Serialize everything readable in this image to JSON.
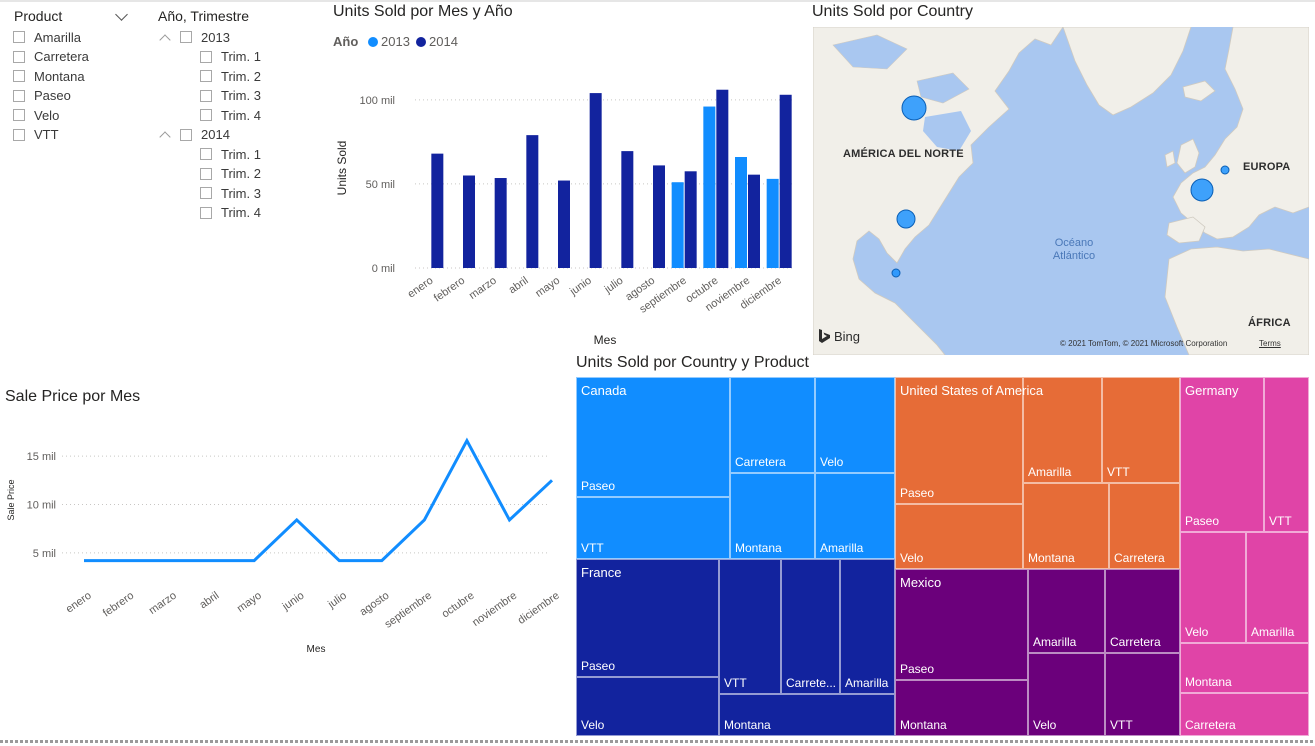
{
  "product_slicer": {
    "title": "Product",
    "items": [
      "Amarilla",
      "Carretera",
      "Montana",
      "Paseo",
      "Velo",
      "VTT"
    ]
  },
  "date_slicer": {
    "title": "Año, Trimestre",
    "years": [
      {
        "label": "2013",
        "quarters": [
          "Trim. 1",
          "Trim. 2",
          "Trim. 3",
          "Trim. 4"
        ]
      },
      {
        "label": "2014",
        "quarters": [
          "Trim. 1",
          "Trim. 2",
          "Trim. 3",
          "Trim. 4"
        ]
      }
    ]
  },
  "bar_chart_title": "Units Sold por Mes y Año",
  "line_chart_title": "Sale Price por Mes",
  "map_title": "Units Sold por Country",
  "treemap_title": "Units Sold por Country y Product",
  "chart_data": [
    {
      "type": "bar",
      "title": "Units Sold por Mes y Año",
      "legend_title": "Año",
      "legend_position": "top-left",
      "xlabel": "Mes",
      "ylabel": "Units Sold",
      "categories": [
        "enero",
        "febrero",
        "marzo",
        "abril",
        "mayo",
        "junio",
        "julio",
        "agosto",
        "septiembre",
        "octubre",
        "noviembre",
        "diciembre"
      ],
      "series": [
        {
          "name": "2013",
          "color": "#118DFF",
          "values": [
            null,
            null,
            null,
            null,
            null,
            null,
            null,
            null,
            51000,
            96000,
            66000,
            53000
          ]
        },
        {
          "name": "2014",
          "color": "#12239E",
          "values": [
            68000,
            55000,
            53500,
            79000,
            52000,
            104000,
            69500,
            61000,
            57500,
            106000,
            55500,
            103000
          ]
        }
      ],
      "yticks": [
        "0 mil",
        "50 mil",
        "100 mil"
      ],
      "ylim": [
        0,
        110000
      ],
      "grid": true
    },
    {
      "type": "line",
      "title": "Sale Price por Mes",
      "xlabel": "Mes",
      "ylabel": "Sale Price",
      "categories": [
        "enero",
        "febrero",
        "marzo",
        "abril",
        "mayo",
        "junio",
        "julio",
        "agosto",
        "septiembre",
        "octubre",
        "noviembre",
        "diciembre"
      ],
      "series": [
        {
          "color": "#118DFF",
          "values": [
            4200,
            4200,
            4200,
            4200,
            4200,
            8400,
            4200,
            4200,
            8400,
            16600,
            8400,
            12500
          ]
        }
      ],
      "yticks": [
        "5 mil",
        "10 mil",
        "15 mil"
      ],
      "ylim": [
        2500,
        17500
      ],
      "grid": true
    }
  ],
  "map": {
    "labels": [
      "AMÉRICA DEL NORTE",
      "EUROPA",
      "ÁFRICA"
    ],
    "ocean_label": [
      "Océano",
      "Atlántico"
    ],
    "bing_label": "Bing",
    "copyright": "© 2021 TomTom, © 2021 Microsoft Corporation",
    "terms": "Terms",
    "bubble_color": "#118DFF",
    "bubbles": [
      {
        "country": "Canada",
        "size": "large"
      },
      {
        "country": "United States of America",
        "size": "medium"
      },
      {
        "country": "Mexico",
        "size": "small"
      },
      {
        "country": "France",
        "size": "large"
      },
      {
        "country": "Germany",
        "size": "small"
      }
    ]
  },
  "treemap": {
    "groups": [
      {
        "name": "Canada",
        "color": "#118DFF",
        "products": [
          "Paseo",
          "VTT",
          "Carretera",
          "Velo",
          "Montana",
          "Amarilla"
        ]
      },
      {
        "name": "France",
        "color": "#12239E",
        "products": [
          "Paseo",
          "Velo",
          "VTT",
          "Carrete...",
          "Amarilla",
          "Montana"
        ]
      },
      {
        "name": "United States of America",
        "color": "#E66C37",
        "products": [
          "Paseo",
          "Velo",
          "Amarilla",
          "VTT",
          "Montana",
          "Carretera"
        ]
      },
      {
        "name": "Mexico",
        "color": "#6B007B",
        "products": [
          "Paseo",
          "Montana",
          "Amarilla",
          "Carretera",
          "Velo",
          "VTT"
        ]
      },
      {
        "name": "Germany",
        "color": "#E044A7",
        "products": [
          "Paseo",
          "VTT",
          "Velo",
          "Amarilla",
          "Montana",
          "Carretera"
        ]
      }
    ]
  }
}
